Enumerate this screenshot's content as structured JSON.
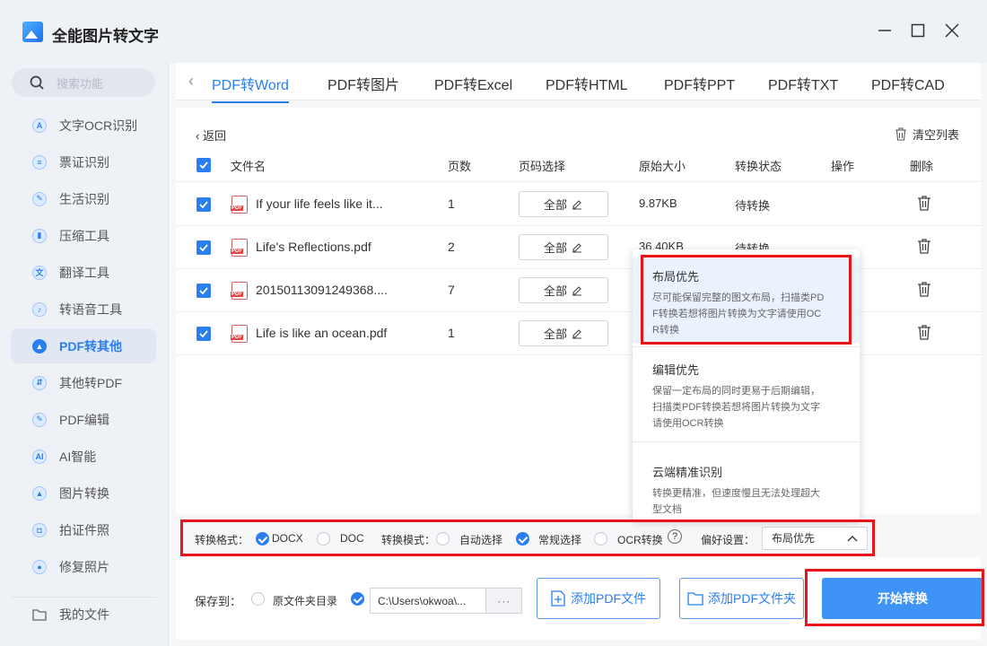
{
  "app": {
    "title": "全能图片转文字"
  },
  "window": {
    "minimize": "—",
    "maximize": "☐",
    "close": "✕"
  },
  "search": {
    "placeholder": "搜索功能"
  },
  "sidebar": {
    "items": [
      {
        "label": "文字OCR识别",
        "icon": "A"
      },
      {
        "label": "票证识别",
        "icon": "≡"
      },
      {
        "label": "生活识别",
        "icon": "✎"
      },
      {
        "label": "压缩工具",
        "icon": "▮"
      },
      {
        "label": "翻译工具",
        "icon": "文"
      },
      {
        "label": "转语音工具",
        "icon": "♪"
      },
      {
        "label": "PDF转其他",
        "icon": "▲"
      },
      {
        "label": "其他转PDF",
        "icon": "⇵"
      },
      {
        "label": "PDF编辑",
        "icon": "✎"
      },
      {
        "label": "AI智能",
        "icon": "AI"
      },
      {
        "label": "图片转换",
        "icon": "▲"
      },
      {
        "label": "拍证件照",
        "icon": "◘"
      },
      {
        "label": "修复照片",
        "icon": "●"
      }
    ],
    "my_files": "我的文件"
  },
  "tabs": [
    "PDF转Word",
    "PDF转图片",
    "PDF转Excel",
    "PDF转HTML",
    "PDF转PPT",
    "PDF转TXT",
    "PDF转CAD"
  ],
  "panel": {
    "back": "返回",
    "clear": "清空列表",
    "headers": {
      "name": "文件名",
      "pages": "页数",
      "range": "页码选择",
      "size": "原始大小",
      "status": "转换状态",
      "action": "操作",
      "delete": "删除"
    }
  },
  "files": [
    {
      "name": "If your life feels like it...",
      "pages": "1",
      "range": "全部",
      "size": "9.87KB",
      "status": "待转换"
    },
    {
      "name": "Life's Reflections.pdf",
      "pages": "2",
      "range": "全部",
      "size": "36.40KB",
      "status": "待转换"
    },
    {
      "name": "20150113091249368....",
      "pages": "7",
      "range": "全部",
      "size": "",
      "status": ""
    },
    {
      "name": "Life is like an ocean.pdf",
      "pages": "1",
      "range": "全部",
      "size": "",
      "status": ""
    }
  ],
  "options": {
    "format_label": "转换格式：",
    "format_docx": "DOCX",
    "format_doc": "DOC",
    "mode_label": "转换模式：",
    "mode_auto": "自动选择",
    "mode_normal": "常规选择",
    "mode_ocr": "OCR转换",
    "help": "?",
    "pref_label": "偏好设置：",
    "pref_value": "布局优先"
  },
  "popup": [
    {
      "title": "布局优先",
      "desc": [
        "尽可能保留完整的图文布局，扫描类PD",
        "F转换若想将图片转换为文字请使用OC",
        "R转换"
      ]
    },
    {
      "title": "编辑优先",
      "desc": [
        "保留一定布局的同时更易于后期编辑，",
        "扫描类PDF转换若想将图片转换为文字",
        "请使用OCR转换"
      ]
    },
    {
      "title": "云端精准识别",
      "desc": [
        "转换更精准，但速度慢且无法处理超大",
        "型文档"
      ]
    }
  ],
  "bottom": {
    "save_to": "保存到：",
    "orig_dir": "原文件夹目录",
    "path": "C:\\Users\\okwoa\\...",
    "more": "···",
    "add_file": "添加PDF文件",
    "add_folder": "添加PDF文件夹",
    "start": "开始转换"
  },
  "colors": {
    "accent": "#2a7ef0",
    "highlight": "#e8141a"
  }
}
